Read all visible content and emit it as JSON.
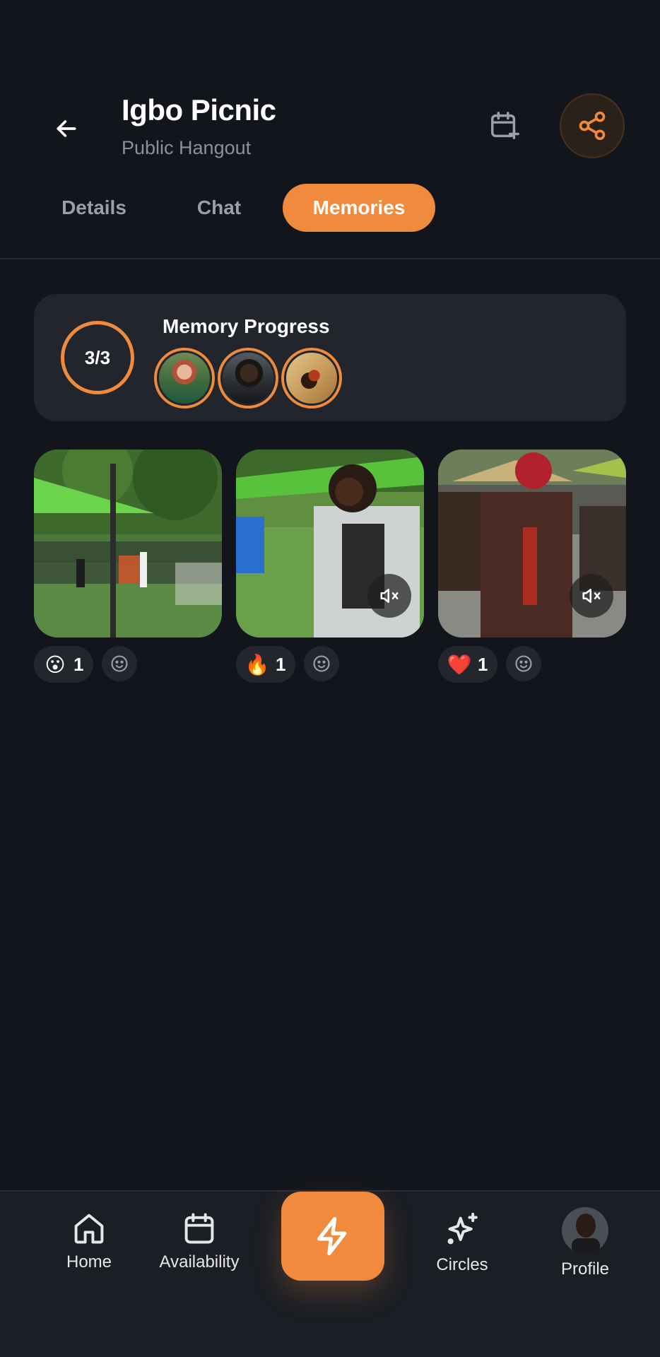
{
  "header": {
    "title": "Igbo Picnic",
    "subtitle": "Public Hangout",
    "back_icon": "arrow-left-icon",
    "calendar_icon": "calendar-plus-icon",
    "share_icon": "share-icon"
  },
  "tabs": [
    {
      "label": "Details",
      "active": false
    },
    {
      "label": "Chat",
      "active": false
    },
    {
      "label": "Memories",
      "active": true
    }
  ],
  "progress": {
    "title": "Memory Progress",
    "count_text": "3/3",
    "contributors": [
      "avatar-1",
      "avatar-2",
      "avatar-3"
    ]
  },
  "memories": [
    {
      "type": "photo",
      "reaction_emoji": "😮",
      "reaction_count": "1",
      "has_mute": false
    },
    {
      "type": "video",
      "reaction_emoji": "🔥",
      "reaction_count": "1",
      "has_mute": true
    },
    {
      "type": "video",
      "reaction_emoji": "❤️",
      "reaction_count": "1",
      "has_mute": true
    }
  ],
  "nav": {
    "home": "Home",
    "availability": "Availability",
    "circles": "Circles",
    "profile": "Profile"
  },
  "colors": {
    "accent": "#f08a3c",
    "background": "#12151c",
    "card": "#22252c"
  }
}
